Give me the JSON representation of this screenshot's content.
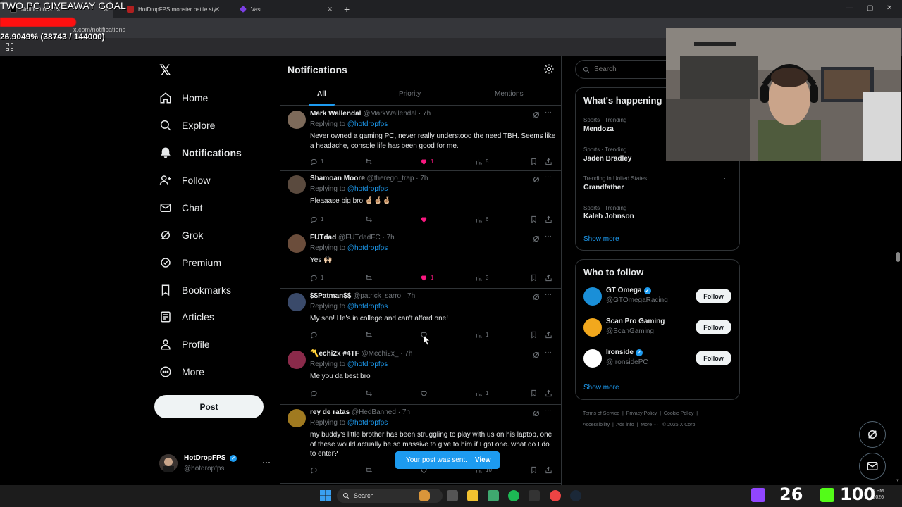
{
  "overlay": {
    "giveaway_title": "TWO PC GIVEAWAY GOAL",
    "giveaway_progress": "26.9049% (38743 / 144000)",
    "progress_fraction": 0.269,
    "progress_color": "#ff1010"
  },
  "browser": {
    "tabs": [
      {
        "label": "Notifications / X",
        "icon": "x-logo-icon"
      },
      {
        "label": "HotDropFPS monster battle style",
        "icon": "hotdrop-icon"
      },
      {
        "label": "Vast",
        "icon": "vast-icon"
      }
    ],
    "url": "x.com/notifications"
  },
  "nav": {
    "items": [
      {
        "label": "Home",
        "icon": "home-icon"
      },
      {
        "label": "Explore",
        "icon": "search-icon"
      },
      {
        "label": "Notifications",
        "icon": "bell-icon",
        "active": true
      },
      {
        "label": "Follow",
        "icon": "add-person-icon"
      },
      {
        "label": "Chat",
        "icon": "mail-icon"
      },
      {
        "label": "Grok",
        "icon": "grok-icon"
      },
      {
        "label": "Premium",
        "icon": "premium-icon"
      },
      {
        "label": "Bookmarks",
        "icon": "bookmark-icon"
      },
      {
        "label": "Articles",
        "icon": "article-icon"
      },
      {
        "label": "Profile",
        "icon": "person-icon"
      },
      {
        "label": "More",
        "icon": "more-circle-icon"
      }
    ],
    "post_label": "Post",
    "account": {
      "name": "HotDropFPS",
      "handle": "@hotdropfps"
    }
  },
  "main": {
    "title": "Notifications",
    "tabs": [
      "All",
      "Priority",
      "Mentions"
    ],
    "active_tab": "All",
    "replying_label": "Replying to",
    "replying_handle": "@hotdropfps",
    "tweets": [
      {
        "name": "Mark Wallendal",
        "handle": "@MarkWallendal",
        "time": "7h",
        "body": "Never owned a gaming PC, never really understood the need TBH. Seems like a headache, console life has been good for me.",
        "replies": "1",
        "retweets": "",
        "likes": "1",
        "liked": true,
        "views": "5"
      },
      {
        "name": "Shamoan Moore",
        "handle": "@therego_trap",
        "time": "7h",
        "body": "Pleaaase big bro 🤞🏼🤞🏼🤞🏼",
        "replies": "1",
        "retweets": "",
        "likes": "",
        "liked": true,
        "views": "6"
      },
      {
        "name": "FUTdad",
        "handle": "@FUTdadFC",
        "time": "7h",
        "body": "Yes 🙌🏻",
        "replies": "1",
        "retweets": "",
        "likes": "1",
        "liked": true,
        "views": "3"
      },
      {
        "name": "$$Patman$$",
        "handle": "@patrick_sarro",
        "time": "7h",
        "body": "My son!  He's in college and can't afford one!",
        "replies": "",
        "retweets": "",
        "likes": "",
        "liked": false,
        "views": "1"
      },
      {
        "name": "〽️echi2x #4TF",
        "handle": "@Mechi2x_",
        "time": "7h",
        "body": "Me you da best bro",
        "replies": "",
        "retweets": "",
        "likes": "",
        "liked": false,
        "views": "1"
      },
      {
        "name": "rey de ratas",
        "handle": "@HedBanned",
        "time": "7h",
        "body": "my buddy's little brother has been struggling to play with us on his laptop, one of these would actually be so massive to give to him if I got one. what do I do to enter?",
        "replies": "",
        "retweets": "",
        "likes": "",
        "liked": false,
        "views": "10"
      }
    ]
  },
  "right": {
    "search_placeholder": "Search",
    "happening_title": "What's happening",
    "trends": [
      {
        "meta": "Sports · Trending",
        "name": "Mendoza"
      },
      {
        "meta": "Sports · Trending",
        "name": "Jaden Bradley"
      },
      {
        "meta": "Trending in United States",
        "name": "Grandfather"
      },
      {
        "meta": "Sports · Trending",
        "name": "Kaleb Johnson"
      }
    ],
    "show_more": "Show more",
    "wtf_title": "Who to follow",
    "follow_label": "Follow",
    "who_to_follow": [
      {
        "name": "GT Omega",
        "handle": "@GTOmegaRacing",
        "verified": true,
        "color": "#1a8fd8"
      },
      {
        "name": "Scan Pro Gaming",
        "handle": "@ScanGaming",
        "verified": false,
        "color": "#f2a81d"
      },
      {
        "name": "Ironside",
        "handle": "@IronsidePC",
        "verified": true,
        "color": "#ffffff"
      }
    ],
    "footer": {
      "line1": [
        "Terms of Service",
        "Privacy Policy",
        "Cookie Policy"
      ],
      "line2": [
        "Accessibility",
        "Ads info",
        "More ···",
        "© 2026 X Corp."
      ]
    }
  },
  "toast": {
    "message": "Your post was sent.",
    "action": "View"
  },
  "taskbar": {
    "search_label": "Search",
    "counter_a": "26",
    "counter_b": "100",
    "time": "6:00 PM",
    "date": "2026"
  },
  "colors": {
    "accent": "#1d9bf0",
    "like": "#f91880",
    "border": "#2f3336",
    "muted": "#71767b"
  }
}
